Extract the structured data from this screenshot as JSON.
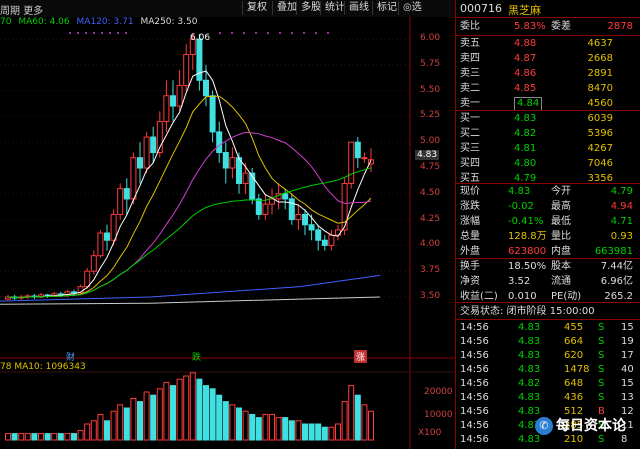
{
  "toolbar": {
    "period": "周期",
    "more": "更多",
    "buttons": [
      "复权",
      "叠加",
      "多股",
      "统计",
      "画线",
      "标记",
      "◎选"
    ]
  },
  "ma_legend": {
    "ma60": "MA60: 4.06",
    "ma120": "MA120: 3.71",
    "ma250": "MA250: 3.50",
    "left_value": "70"
  },
  "vol_legend": {
    "left_value": "78",
    "ma10": "MA10: 1096343"
  },
  "price_axis": [
    "6.00",
    "5.75",
    "5.50",
    "5.25",
    "5.00",
    "4.75",
    "4.50",
    "4.25",
    "4.00",
    "3.75",
    "3.50"
  ],
  "current_price_tag": "4.83",
  "high_label": "6.06",
  "vol_axis": [
    "20000",
    "10000",
    "X100"
  ],
  "event_labels": {
    "cai": "财",
    "die": "跌",
    "zhang": "涨"
  },
  "quote": {
    "code": "000716",
    "name": "黑芝麻",
    "weibi_label": "委比",
    "weibi_value": "5.83%",
    "weicha_label": "委差",
    "weicha_value": "2878",
    "sell": [
      {
        "label": "卖五",
        "price": "4.88",
        "vol": "4637"
      },
      {
        "label": "卖四",
        "price": "4.87",
        "vol": "2668"
      },
      {
        "label": "卖三",
        "price": "4.86",
        "vol": "2891"
      },
      {
        "label": "卖二",
        "price": "4.85",
        "vol": "8470"
      },
      {
        "label": "卖一",
        "price": "4.84",
        "vol": "4560"
      }
    ],
    "buy": [
      {
        "label": "买一",
        "price": "4.83",
        "vol": "6039"
      },
      {
        "label": "买二",
        "price": "4.82",
        "vol": "5396"
      },
      {
        "label": "买三",
        "price": "4.81",
        "vol": "4267"
      },
      {
        "label": "买四",
        "price": "4.80",
        "vol": "7046"
      },
      {
        "label": "买五",
        "price": "4.79",
        "vol": "3356"
      }
    ],
    "stats": [
      {
        "l1": "现价",
        "v1": "4.83",
        "l2": "今开",
        "v2": "4.79"
      },
      {
        "l1": "涨跌",
        "v1": "-0.02",
        "l2": "最高",
        "v2": "4.94"
      },
      {
        "l1": "涨幅",
        "v1": "-0.41%",
        "l2": "最低",
        "v2": "4.71"
      },
      {
        "l1": "总量",
        "v1": "128.8万",
        "l2": "量比",
        "v2": "0.93"
      },
      {
        "l1": "外盘",
        "v1": "623800",
        "l2": "内盘",
        "v2": "663981"
      }
    ],
    "stats2": [
      {
        "l1": "换手",
        "v1": "18.50%",
        "l2": "股本",
        "v2": "7.44亿"
      },
      {
        "l1": "净资",
        "v1": "3.52",
        "l2": "流通",
        "v2": "6.96亿"
      },
      {
        "l1": "收益(二)",
        "v1": "0.010",
        "l2": "PE(动)",
        "v2": "265.2"
      }
    ],
    "status": "交易状态: 闭市阶段 15:00:00",
    "ticks": [
      {
        "time": "14:56",
        "price": "4.83",
        "vol": "455",
        "flag": "S",
        "num": "15"
      },
      {
        "time": "14:56",
        "price": "4.83",
        "vol": "664",
        "flag": "S",
        "num": "19"
      },
      {
        "time": "14:56",
        "price": "4.83",
        "vol": "620",
        "flag": "S",
        "num": "17"
      },
      {
        "time": "14:56",
        "price": "4.83",
        "vol": "1478",
        "flag": "S",
        "num": "40"
      },
      {
        "time": "14:56",
        "price": "4.82",
        "vol": "648",
        "flag": "S",
        "num": "15"
      },
      {
        "time": "14:56",
        "price": "4.83",
        "vol": "436",
        "flag": "S",
        "num": "13"
      },
      {
        "time": "14:56",
        "price": "4.83",
        "vol": "512",
        "flag": "B",
        "num": "12"
      },
      {
        "time": "14:56",
        "price": "4.83",
        "vol": "285",
        "flag": "S",
        "num": "11"
      },
      {
        "time": "14:56",
        "price": "4.83",
        "vol": "210",
        "flag": "S",
        "num": "8"
      }
    ]
  },
  "watermark": "每日资本论",
  "colors": {
    "up": "#ff3b3b",
    "down": "#00d000",
    "ma5": "#ffffff",
    "ma10": "#e0c000",
    "ma20": "#d040d0",
    "ma60": "#00d000",
    "ma120": "#4060ff",
    "ma250": "#ffffff"
  }
}
